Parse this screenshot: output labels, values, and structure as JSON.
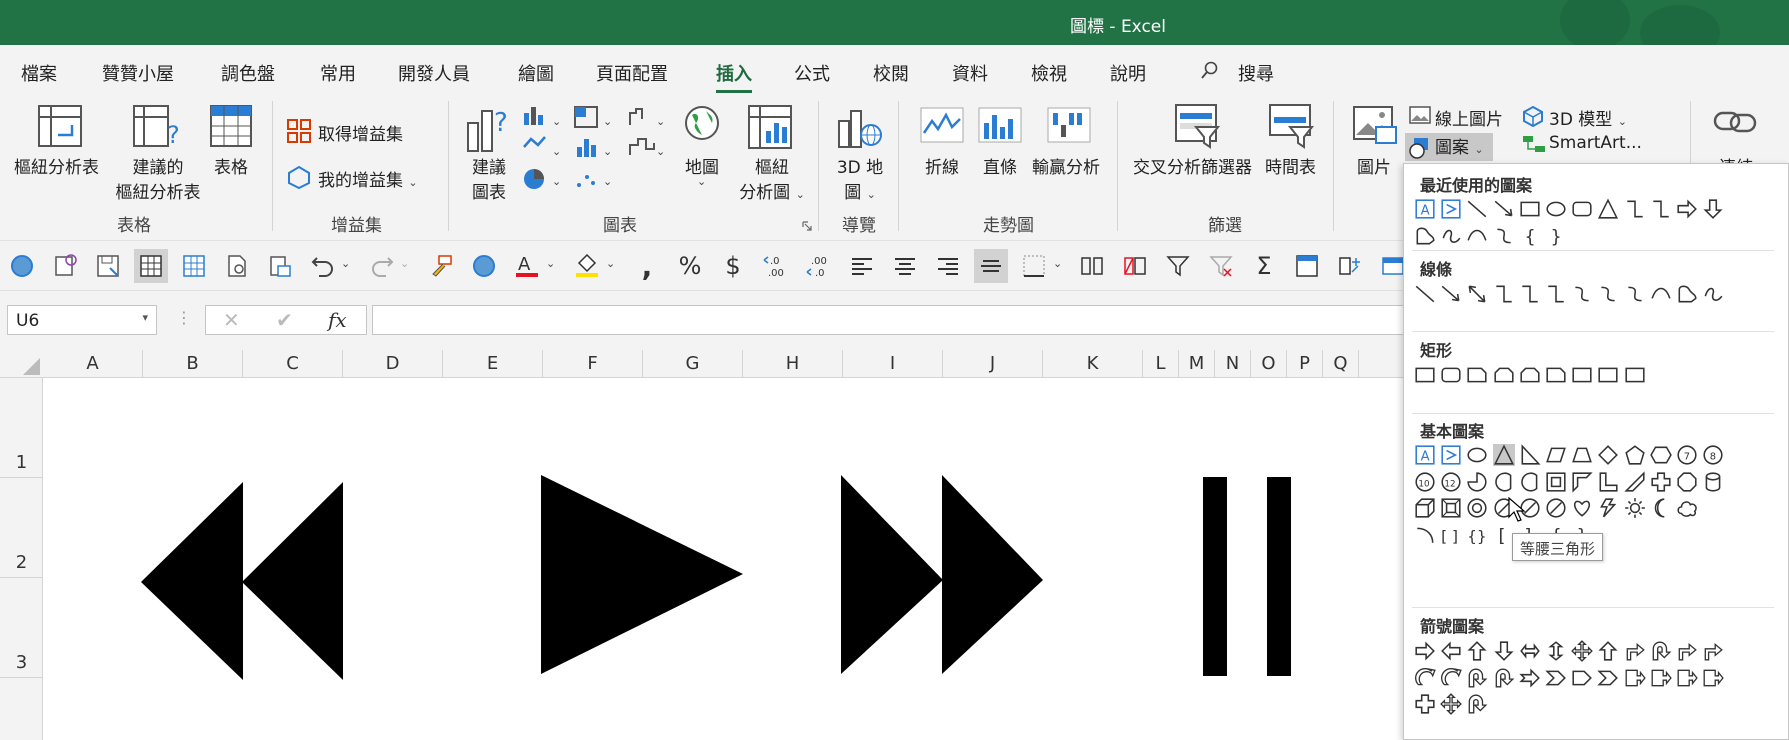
{
  "window": {
    "title": "圖標  -  Excel"
  },
  "tabs": [
    "檔案",
    "贊贊小屋",
    "調色盤",
    "常用",
    "開發人員",
    "繪圖",
    "頁面配置",
    "插入",
    "公式",
    "校閱",
    "資料",
    "檢視",
    "說明"
  ],
  "active_tab": "插入",
  "search": {
    "label": "搜尋"
  },
  "ribbon": {
    "pivot_table": "樞紐分析表",
    "recommended_pivot": [
      "建議的",
      "樞紐分析表"
    ],
    "table": "表格",
    "get_addins": "取得增益集",
    "my_addins": "我的增益集",
    "recommended_charts": [
      "建議",
      "圖表"
    ],
    "maps": "地圖",
    "pivot_chart": [
      "樞紐",
      "分析圖"
    ],
    "map_3d": [
      "3D 地",
      "圖"
    ],
    "line": "折線",
    "column": "直條",
    "win_loss": "輸贏分析",
    "slicer": "交叉分析篩選器",
    "timeline": "時間表",
    "pictures": "圖片",
    "online_pictures": "線上圖片",
    "models_3d": "3D 模型",
    "shapes": "圖案",
    "smartart": "SmartArt...",
    "link": "連結",
    "groups": {
      "tables": "表格",
      "addins": "增益集",
      "charts": "圖表",
      "tours": "導覽",
      "sparklines": "走勢圖",
      "filters": "篩選"
    }
  },
  "formula_bar": {
    "name_box": "U6",
    "cancel": "✕",
    "enter": "✔",
    "fx": "fx",
    "formula": ""
  },
  "columns": [
    "A",
    "B",
    "C",
    "D",
    "E",
    "F",
    "G",
    "H",
    "I",
    "J",
    "K",
    "L",
    "M",
    "N",
    "O",
    "P",
    "Q"
  ],
  "rows": [
    "1",
    "2",
    "3"
  ],
  "shapes_gallery": {
    "recent": "最近使用的圖案",
    "lines": "線條",
    "rectangles": "矩形",
    "basic": "基本圖案",
    "block_arrows": "箭號圖案",
    "tooltip": "等腰三角形"
  },
  "colors": {
    "title_bar": "#217346",
    "accent_font": "#e81123",
    "highlight": "#ffe100"
  }
}
